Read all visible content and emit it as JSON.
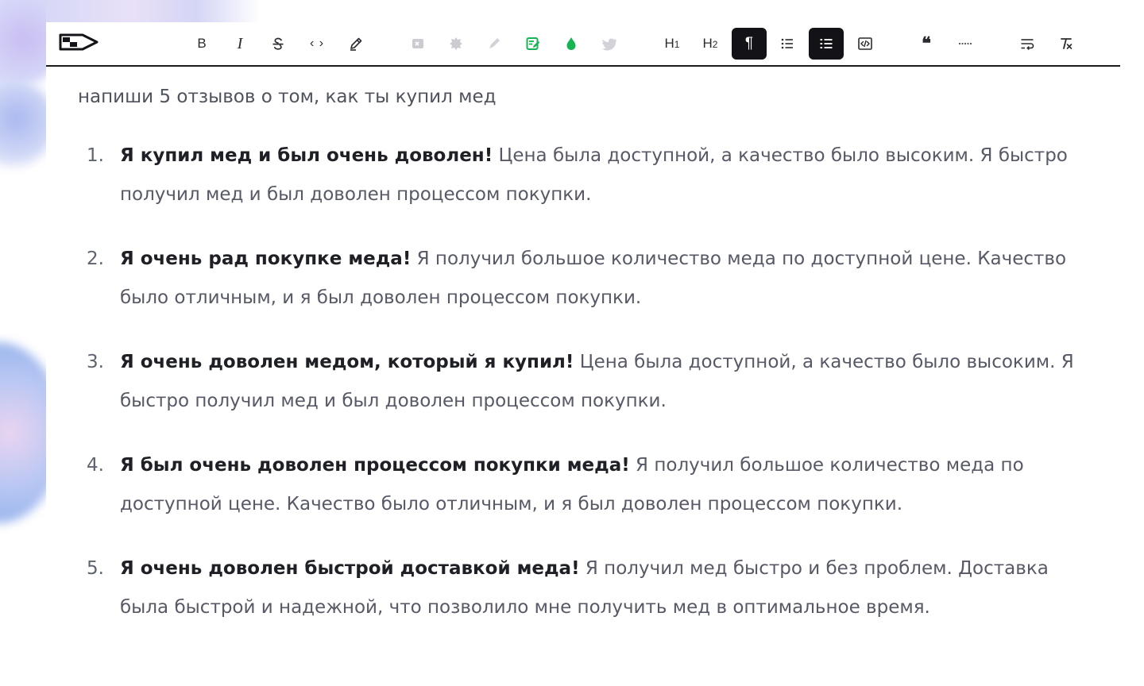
{
  "toolbar": {
    "buttons": [
      {
        "id": "bold",
        "icon": "bold-icon",
        "label": "B"
      },
      {
        "id": "italic",
        "icon": "italic-icon",
        "label": "I"
      },
      {
        "id": "strikethrough",
        "icon": "strikethrough-icon"
      },
      {
        "id": "inline-code",
        "icon": "code-icon",
        "label": "‹ ›"
      },
      {
        "id": "highlight",
        "icon": "pencil-icon"
      },
      {
        "id": "disabled-1",
        "icon": "image-icon",
        "state": "disabled"
      },
      {
        "id": "disabled-2",
        "icon": "badge-icon",
        "state": "disabled"
      },
      {
        "id": "disabled-3",
        "icon": "pen-icon",
        "state": "disabled"
      },
      {
        "id": "green-edit",
        "icon": "edit-note-icon",
        "color": "#16b453"
      },
      {
        "id": "green-drop",
        "icon": "droplet-icon",
        "color": "#16b453"
      },
      {
        "id": "disabled-4",
        "icon": "bird-icon",
        "state": "disabled"
      },
      {
        "id": "h1",
        "icon": "heading-1-icon",
        "label": "H",
        "sub": "1"
      },
      {
        "id": "h2",
        "icon": "heading-2-icon",
        "label": "H",
        "sub": "2"
      },
      {
        "id": "paragraph",
        "icon": "paragraph-icon",
        "label": "¶",
        "state": "active"
      },
      {
        "id": "bullet-list",
        "icon": "bullet-list-icon"
      },
      {
        "id": "ordered-list",
        "icon": "ordered-list-icon",
        "state": "active"
      },
      {
        "id": "code-block",
        "icon": "code-block-icon"
      },
      {
        "id": "quote",
        "icon": "quote-icon",
        "label": "❝"
      },
      {
        "id": "divider",
        "icon": "horizontal-rule-icon"
      },
      {
        "id": "wrap",
        "icon": "text-wrap-icon"
      },
      {
        "id": "clear-format",
        "icon": "clear-format-icon"
      }
    ]
  },
  "prompt": "напиши 5 отзывов о том, как ты купил мед",
  "responses": [
    {
      "num": "1.",
      "bold": "Я купил мед и был очень доволен!",
      "rest": " Цена была доступной, а качество было высоким. Я быстро получил мед и был доволен процессом покупки."
    },
    {
      "num": "2.",
      "bold": "Я очень рад покупке меда!",
      "rest": " Я получил большое количество меда по доступной цене. Качество было отличным, и я был доволен процессом покупки."
    },
    {
      "num": "3.",
      "bold": "Я очень доволен медом, который я купил!",
      "rest": " Цена была доступной, а качество было высоким. Я быстро получил мед и был доволен процессом покупки."
    },
    {
      "num": "4.",
      "bold": "Я был очень доволен процессом покупки меда!",
      "rest": " Я получил большое количество меда по доступной цене. Качество было отличным, и я был доволен процессом покупки."
    },
    {
      "num": "5.",
      "bold": "Я очень доволен быстрой доставкой меда!",
      "rest": " Я получил мед быстро и без проблем. Доставка была быстрой и надежной, что позволило мне получить мед в оптимальное время."
    }
  ]
}
